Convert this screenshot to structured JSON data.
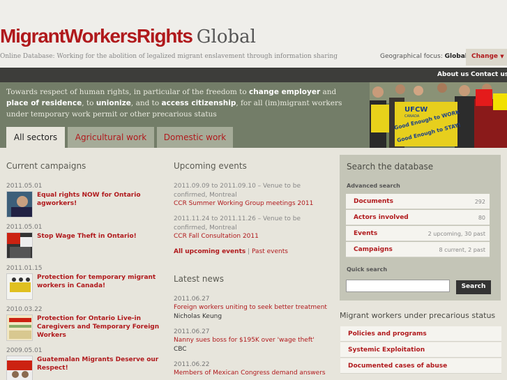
{
  "header": {
    "logo_main": "MigrantWorkersRights",
    "logo_global": "Global",
    "tagline": "Online Database: Working for the abolition of legalized migrant enslavement through information sharing",
    "geo_label": "Geographical focus:",
    "geo_value": "Global",
    "change_label": "Change",
    "brand_color": "#b0191c"
  },
  "topnav": {
    "about": "About us",
    "contact": "Contact us"
  },
  "banner": {
    "t1": "Towards respect of human rights, in particular of the freedom to ",
    "b1": "change employer",
    "t2": " and ",
    "b2": "place of residence",
    "t3": ", to ",
    "b3": "unionize",
    "t4": ", and to ",
    "b4": "access citizenship",
    "t5": ", for all (im)migrant workers under temporary work permit or other precarious status"
  },
  "tabs": [
    "All sectors",
    "Agricultural work",
    "Domestic work"
  ],
  "photo": {
    "sign_brand": "UFCW",
    "sign_country": "CANADA",
    "sign_line1": "Good Enough to WORK",
    "sign_line2": "Good Enough to STAY!"
  },
  "campaigns": {
    "heading": "Current campaigns",
    "items": [
      {
        "date": "2011.05.01",
        "title": "Equal rights NOW for Ontario agworkers!"
      },
      {
        "date": "2011.05.01",
        "title": "Stop Wage Theft in Ontario!"
      },
      {
        "date": "2011.01.15",
        "title": "Protection for temporary migrant workers in Canada!"
      },
      {
        "date": "2010.03.22",
        "title": "Protection for Ontario Live-in Caregivers and Temporary Foreign Workers"
      },
      {
        "date": "2009.05.01",
        "title": "Guatemalan Migrants Deserve our Respect!"
      }
    ]
  },
  "events": {
    "heading": "Upcoming events",
    "items": [
      {
        "when": "2011.09.09 to 2011.09.10 – Venue to be confirmed, Montreal",
        "title": "CCR Summer Working Group meetings 2011"
      },
      {
        "when": "2011.11.24 to 2011.11.26 – Venue to be confirmed, Montreal",
        "title": "CCR Fall Consultation 2011"
      }
    ],
    "all_upcoming": "All upcoming events",
    "separator": "|",
    "past": "Past events"
  },
  "news": {
    "heading": "Latest news",
    "items": [
      {
        "date": "2011.06.27",
        "title": "Foreign workers uniting to seek better treatment",
        "source": "Nicholas Keung"
      },
      {
        "date": "2011.06.27",
        "title": "Nanny sues boss for $195K over 'wage theft'",
        "source": "CBC"
      },
      {
        "date": "2011.06.22",
        "title": "Members of Mexican Congress demand answers",
        "source": ""
      }
    ]
  },
  "search": {
    "heading": "Search the database",
    "advanced": "Advanced search",
    "rows": [
      {
        "label": "Documents",
        "count": "292"
      },
      {
        "label": "Actors involved",
        "count": "80"
      },
      {
        "label": "Events",
        "count": "2 upcoming, 30 past"
      },
      {
        "label": "Campaigns",
        "count": "8 current, 2 past"
      }
    ],
    "quick": "Quick search",
    "button": "Search"
  },
  "precarious": {
    "heading": "Migrant workers under precarious status",
    "items": [
      "Policies and programs",
      "Systemic Exploitation",
      "Documented cases of abuse"
    ]
  }
}
